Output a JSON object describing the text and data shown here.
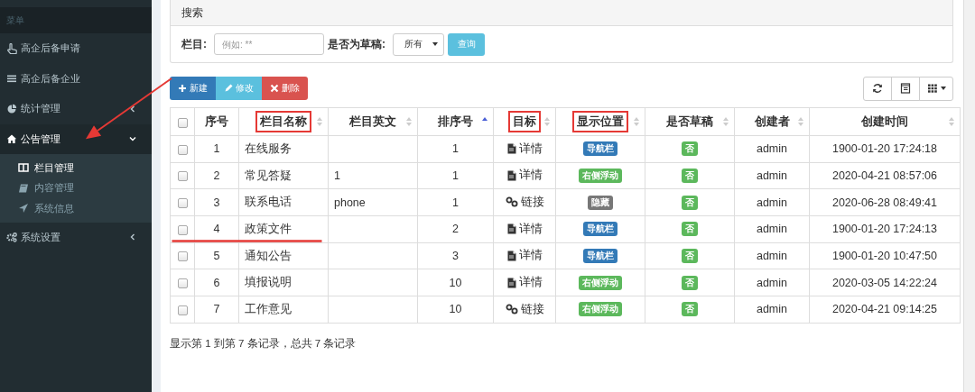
{
  "sidebar": {
    "header": "菜单",
    "items": [
      {
        "label": "高企后备申请",
        "selected": false
      },
      {
        "label": "高企后备企业",
        "selected": false
      },
      {
        "label": "统计管理",
        "selected": false,
        "expanded": false
      },
      {
        "label": "公告管理",
        "selected": true,
        "expanded": true,
        "children": [
          {
            "label": "栏目管理",
            "selected": true
          },
          {
            "label": "内容管理",
            "selected": false
          },
          {
            "label": "系统信息",
            "selected": false
          }
        ]
      },
      {
        "label": "系统设置",
        "selected": false,
        "expanded": false
      }
    ]
  },
  "search": {
    "title": "搜索",
    "fields": [
      {
        "kind": "text",
        "label": "栏目:",
        "placeholder": "例如: **"
      },
      {
        "kind": "select",
        "label": "是否为草稿:",
        "value": "所有"
      }
    ],
    "submit": "查询"
  },
  "toolbar": [
    {
      "kind": "new",
      "label": "新建"
    },
    {
      "kind": "edit",
      "label": "修改"
    },
    {
      "kind": "delete",
      "label": "删除"
    }
  ],
  "table": {
    "header_checked": false,
    "columns": [
      {
        "label": "序号",
        "highlighted": false
      },
      {
        "label": "栏目名称",
        "sortable": true,
        "sorted_ascending": false,
        "highlighted": true
      },
      {
        "label": "栏目英文",
        "sortable": true,
        "sorted_ascending": false,
        "highlighted": false
      },
      {
        "label": "排序号",
        "sortable": true,
        "sorted_ascending": true,
        "highlighted": false
      },
      {
        "label": "目标",
        "sortable": true,
        "sorted_ascending": false,
        "highlighted": true
      },
      {
        "label": "显示位置",
        "sortable": true,
        "sorted_ascending": false,
        "highlighted": true
      },
      {
        "label": "是否草稿",
        "sortable": true,
        "sorted_ascending": false,
        "highlighted": false
      },
      {
        "label": "创建者",
        "sortable": true,
        "sorted_ascending": false,
        "highlighted": false
      },
      {
        "label": "创建时间",
        "sortable": true,
        "sorted_ascending": false,
        "highlighted": false
      }
    ],
    "rows": [
      {
        "checked": false,
        "cells": [
          "1",
          "在线服务",
          "",
          "1"
        ],
        "target": {
          "kind": "doc",
          "label": "详情"
        },
        "position": {
          "label": "导航栏",
          "color": "#337ab7"
        },
        "draft": {
          "label": "否",
          "color": "#5cb85c"
        },
        "creator": "admin",
        "created": "1900-01-20 17:24:18"
      },
      {
        "checked": false,
        "cells": [
          "2",
          "常见答疑",
          "1",
          "1"
        ],
        "target": {
          "kind": "doc",
          "label": "详情"
        },
        "position": {
          "label": "右侧浮动",
          "color": "#5cb85c"
        },
        "draft": {
          "label": "否",
          "color": "#5cb85c"
        },
        "creator": "admin",
        "created": "2020-04-21 08:57:06"
      },
      {
        "checked": false,
        "cells": [
          "3",
          "联系电话",
          "phone",
          "1"
        ],
        "target": {
          "kind": "link",
          "label": "链接"
        },
        "position": {
          "label": "隐藏",
          "color": "#777777"
        },
        "draft": {
          "label": "否",
          "color": "#5cb85c"
        },
        "creator": "admin",
        "created": "2020-06-28 08:49:41"
      },
      {
        "checked": false,
        "underlined": true,
        "cells": [
          "4",
          "政策文件",
          "",
          "2"
        ],
        "target": {
          "kind": "doc",
          "label": "详情"
        },
        "position": {
          "label": "导航栏",
          "color": "#337ab7"
        },
        "draft": {
          "label": "否",
          "color": "#5cb85c"
        },
        "creator": "admin",
        "created": "1900-01-20 17:24:13"
      },
      {
        "checked": false,
        "cells": [
          "5",
          "通知公告",
          "",
          "3"
        ],
        "target": {
          "kind": "doc",
          "label": "详情"
        },
        "position": {
          "label": "导航栏",
          "color": "#337ab7"
        },
        "draft": {
          "label": "否",
          "color": "#5cb85c"
        },
        "creator": "admin",
        "created": "1900-01-20 10:47:50"
      },
      {
        "checked": false,
        "cells": [
          "6",
          "填报说明",
          "",
          "10"
        ],
        "target": {
          "kind": "doc",
          "label": "详情"
        },
        "position": {
          "label": "右侧浮动",
          "color": "#5cb85c"
        },
        "draft": {
          "label": "否",
          "color": "#5cb85c"
        },
        "creator": "admin",
        "created": "2020-03-05 14:22:24"
      },
      {
        "checked": false,
        "cells": [
          "7",
          "工作意见",
          "",
          "10"
        ],
        "target": {
          "kind": "link",
          "label": "链接"
        },
        "position": {
          "label": "右侧浮动",
          "color": "#5cb85c"
        },
        "draft": {
          "label": "否",
          "color": "#5cb85c"
        },
        "creator": "admin",
        "created": "2020-04-21 09:14:25"
      }
    ]
  },
  "pagination_info": "显示第 1 到第 7 条记录，总共 7 条记录",
  "annotations": [
    {
      "kind": "arrow"
    }
  ]
}
